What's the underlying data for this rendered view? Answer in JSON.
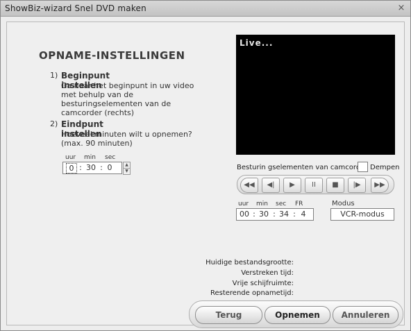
{
  "window": {
    "title": "ShowBiz-wizard Snel DVD maken",
    "close_glyph": "×"
  },
  "section": {
    "heading": "OPNAME-INSTELLINGEN"
  },
  "steps": [
    {
      "number": "1)",
      "title": "Beginpunt instellen",
      "description": "Ga naar het beginpunt in uw video met behulp van de besturingselementen van de camcorder (rechts)"
    },
    {
      "number": "2)",
      "title": "Eindpunt instellen",
      "description": "Hoeveel minuten wilt u opnemen? (max. 90 minuten)"
    }
  ],
  "duration_input": {
    "labels": {
      "hours": "uur",
      "minutes": "min",
      "seconds": "sec"
    },
    "values": {
      "hours": "0",
      "minutes": "30",
      "seconds": "0"
    },
    "separator": ":",
    "spin_up": "▲",
    "spin_down": "▼"
  },
  "preview": {
    "live_label": "Live..."
  },
  "camcorder": {
    "controls_label": "Besturin gselementen van camcorder",
    "mute_label": "Dempen",
    "mute_checked": false,
    "buttons": [
      {
        "name": "rewind",
        "glyph": "◀◀",
        "icon": "rewind-icon"
      },
      {
        "name": "step-back",
        "glyph": "◀|",
        "icon": "step-back-icon"
      },
      {
        "name": "play",
        "glyph": "▶",
        "icon": "play-icon"
      },
      {
        "name": "pause",
        "glyph": "II",
        "icon": "pause-icon"
      },
      {
        "name": "stop",
        "glyph": "■",
        "icon": "stop-icon"
      },
      {
        "name": "step-forward",
        "glyph": "|▶",
        "icon": "step-forward-icon"
      },
      {
        "name": "fast-forward",
        "glyph": "▶▶",
        "icon": "fast-forward-icon"
      }
    ],
    "timecode": {
      "labels": {
        "hours": "uur",
        "minutes": "min",
        "seconds": "sec",
        "frames": "FR"
      },
      "values": {
        "hours": "00",
        "minutes": "30",
        "seconds": "34",
        "frames": "4"
      },
      "separator": ":"
    },
    "mode": {
      "label": "Modus",
      "value": "VCR-modus"
    }
  },
  "status": {
    "current_size": "Huidige bestandsgrootte:",
    "elapsed": "Verstreken tijd:",
    "free_space": "Vrije schijfruimte:",
    "remaining": "Resterende opnametijd:"
  },
  "buttons": {
    "back": "Terug",
    "record": "Opnemen",
    "cancel": "Annuleren"
  }
}
